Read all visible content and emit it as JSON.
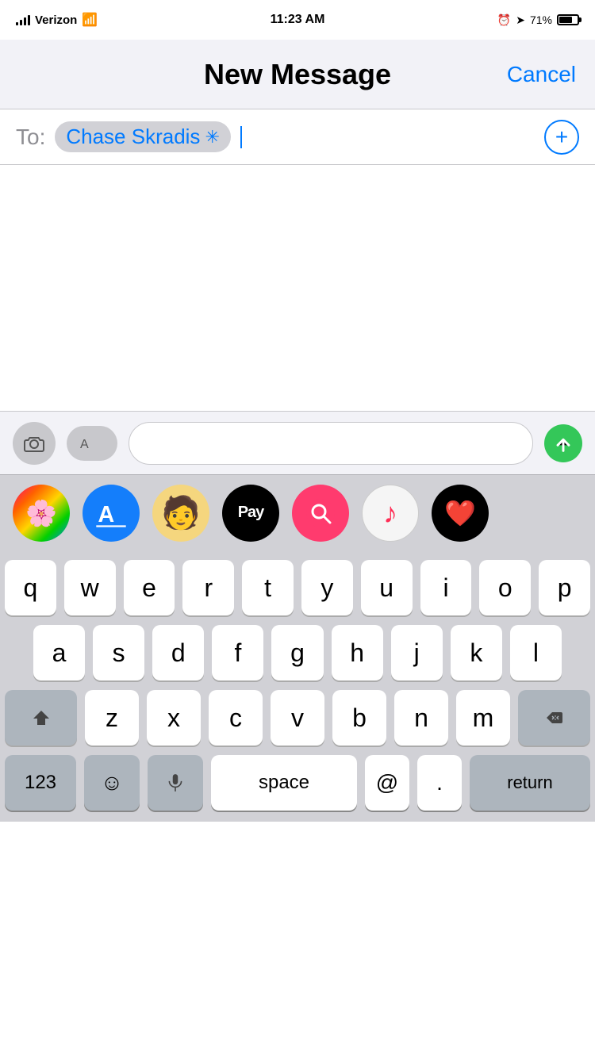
{
  "statusBar": {
    "carrier": "Verizon",
    "time": "11:23 AM",
    "battery": "71%"
  },
  "navBar": {
    "title": "New Message",
    "cancelLabel": "Cancel"
  },
  "toField": {
    "label": "To:",
    "recipientName": "Chase Skradis",
    "placeholder": ""
  },
  "toolbar": {
    "cameraLabel": "camera",
    "appStoreLabel": "appstore",
    "sendLabel": "send"
  },
  "appStrip": {
    "apps": [
      {
        "name": "Photos",
        "icon": "🌸"
      },
      {
        "name": "App Store",
        "icon": "A"
      },
      {
        "name": "Memoji",
        "icon": "🧑"
      },
      {
        "name": "Apple Pay",
        "icon": "Pay"
      },
      {
        "name": "Search",
        "icon": "🔍"
      },
      {
        "name": "Music",
        "icon": "♪"
      },
      {
        "name": "Heart",
        "icon": "❤️"
      }
    ]
  },
  "keyboard": {
    "rows": [
      [
        "q",
        "w",
        "e",
        "r",
        "t",
        "y",
        "u",
        "i",
        "o",
        "p"
      ],
      [
        "a",
        "s",
        "d",
        "f",
        "g",
        "h",
        "j",
        "k",
        "l"
      ],
      [
        "z",
        "x",
        "c",
        "v",
        "b",
        "n",
        "m"
      ]
    ],
    "bottomRow": {
      "numbers": "123",
      "emoji": "☺",
      "mic": "mic",
      "space": "space",
      "at": "@",
      "period": ".",
      "return": "return"
    }
  }
}
